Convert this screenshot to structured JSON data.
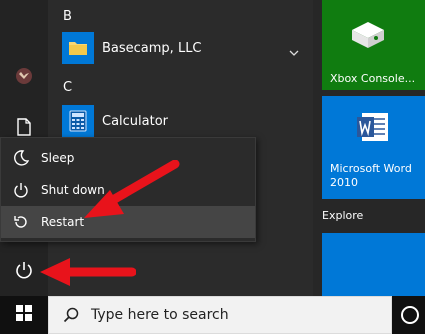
{
  "app_list": {
    "letter_b": "B",
    "letter_c": "C",
    "apps": [
      {
        "label": "Basecamp, LLC",
        "icon": "folder-icon"
      },
      {
        "label": "Calculator",
        "icon": "calculator-icon"
      }
    ]
  },
  "power_menu": {
    "items": [
      {
        "label": "Sleep",
        "icon": "moon-icon"
      },
      {
        "label": "Shut down",
        "icon": "power-icon"
      },
      {
        "label": "Restart",
        "icon": "restart-icon"
      }
    ]
  },
  "tiles": {
    "xbox_label": "Xbox Console...",
    "word_label": "Microsoft Word 2010",
    "section_label": "Explore"
  },
  "taskbar": {
    "search_placeholder": "Type here to search"
  },
  "colors": {
    "tile_blue": "#0078d7",
    "tile_green": "#107c10",
    "arrow_red": "#e8131b"
  }
}
